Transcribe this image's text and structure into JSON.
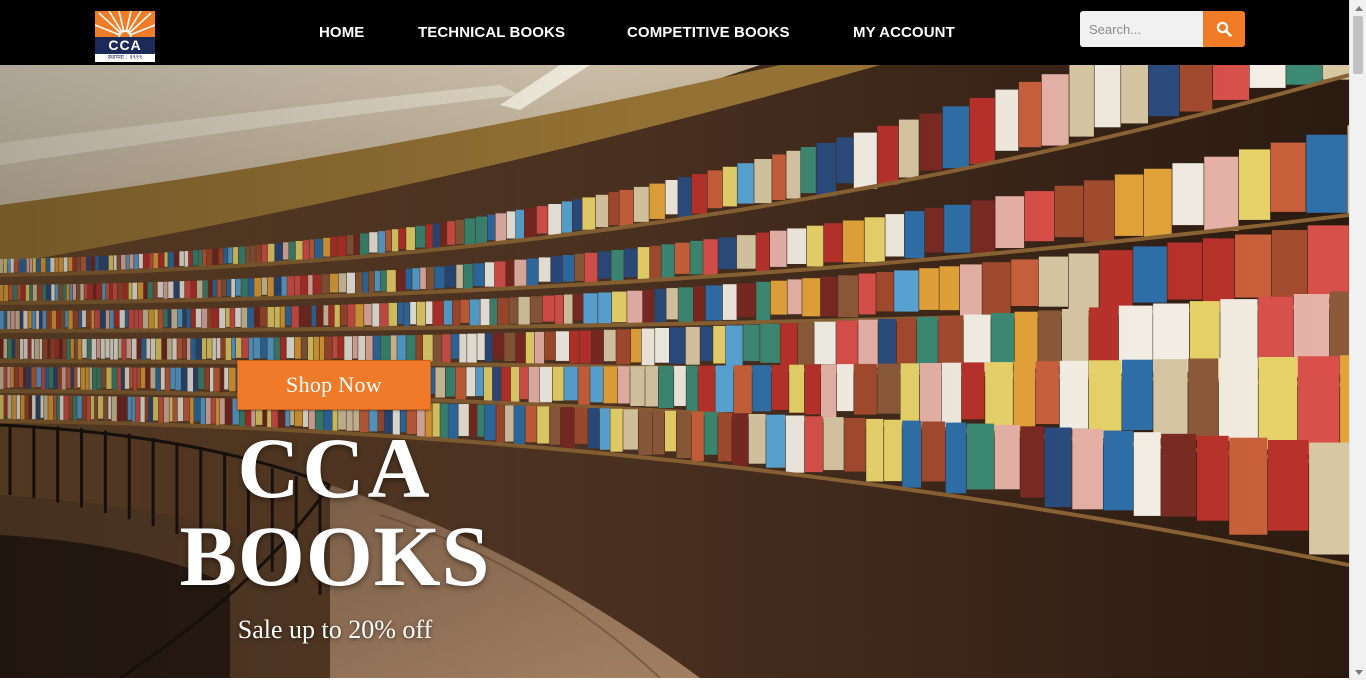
{
  "header": {
    "logo": {
      "text": "CCA",
      "tagline": "स्थापना : १९९९",
      "colors": {
        "sun": "#f07c27",
        "band": "#1c2a57"
      }
    },
    "nav": [
      {
        "label": "HOME"
      },
      {
        "label": "TECHNICAL BOOKS"
      },
      {
        "label": "COMPETITIVE BOOKS"
      },
      {
        "label": "MY ACCOUNT"
      }
    ],
    "search": {
      "placeholder": "Search...",
      "value": "",
      "button_icon": "search-icon"
    }
  },
  "hero": {
    "background": "library-bookshelves-photo",
    "cta_label": "Shop Now",
    "title_line1": "CCA",
    "title_line2": "BOOKS",
    "subtitle": "Sale up to 20% off"
  },
  "theme": {
    "header_bg": "#000000",
    "accent": "#f07c27",
    "hero_text": "#ffffff"
  }
}
